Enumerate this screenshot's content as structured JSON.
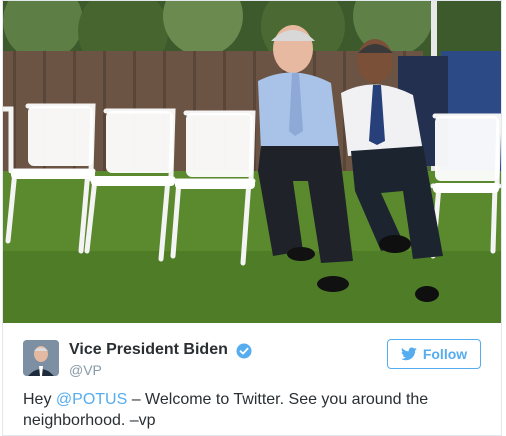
{
  "tweet": {
    "display_name": "Vice President Biden",
    "handle": "@VP",
    "follow_label": "Follow",
    "text_before": "Hey ",
    "mention": "@POTUS",
    "text_after": " – Welcome to Twitter. See you around the neighborhood. –vp"
  },
  "colors": {
    "accent": "#55acee",
    "text": "#292f33",
    "muted": "#8899a6"
  },
  "icons": {
    "verified": "verified-badge-icon",
    "follow": "twitter-bird-icon"
  }
}
